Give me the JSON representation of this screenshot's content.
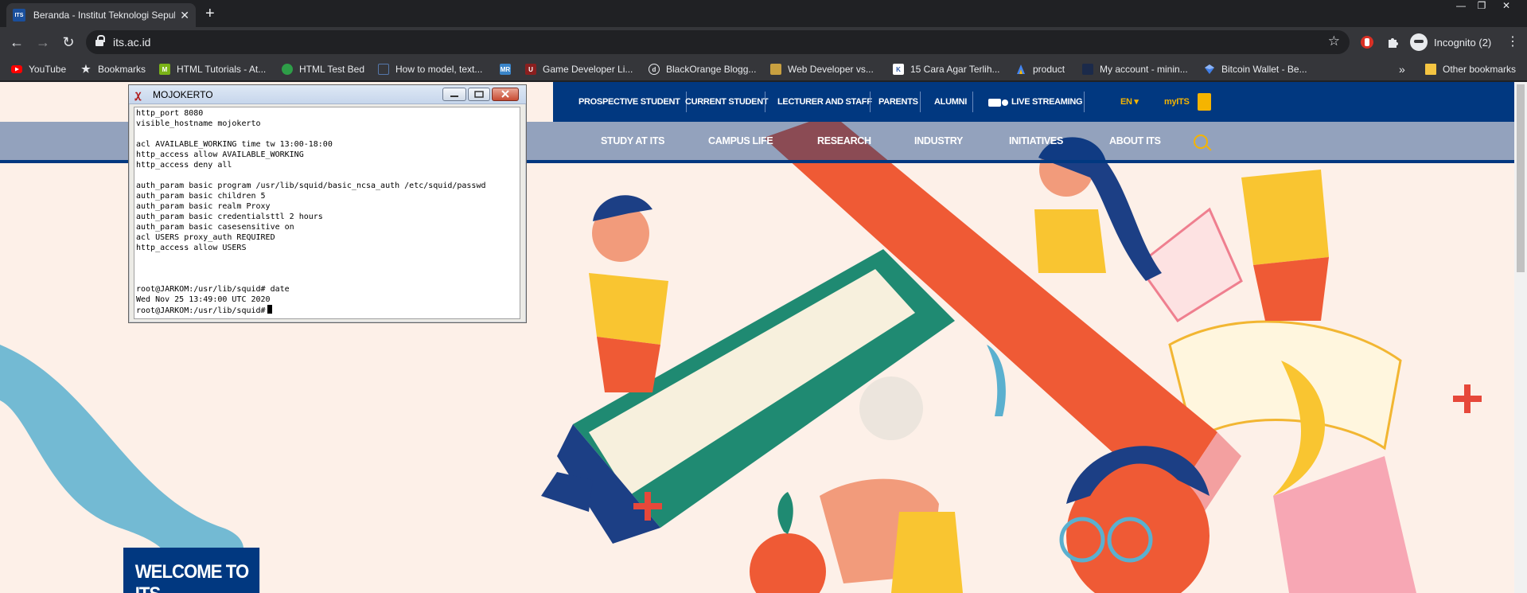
{
  "browser": {
    "tab": {
      "favicon_text": "ITS",
      "title": "Beranda - Institut Teknologi Sepuluh Nopember"
    },
    "newtab_symbol": "+",
    "close_symbol": "✕",
    "window_controls": [
      "—",
      "❐",
      "✕"
    ],
    "address": {
      "url": "its.ac.id"
    },
    "profile_label": "Incognito (2)",
    "bookmarks": [
      {
        "label": "YouTube",
        "icon": "youtube-icon",
        "color": "#ff0000"
      },
      {
        "label": "Bookmarks",
        "icon": "star-icon",
        "color": "#e8eaed"
      },
      {
        "label": "HTML Tutorials - At...",
        "icon": "html-tutorials-icon",
        "color": "#7ab317"
      },
      {
        "label": "HTML Test Bed",
        "icon": "test-bed-icon",
        "color": "#2e9e48"
      },
      {
        "label": "How to model, text...",
        "icon": "model-icon",
        "color": "#5577aa"
      },
      {
        "label": "",
        "icon": "mr-icon",
        "color": "#3a85c9"
      },
      {
        "label": "Game Developer Li...",
        "icon": "unreal-icon",
        "color": "#8a1f1f"
      },
      {
        "label": "BlackOrange Blogg...",
        "icon": "blogger-icon",
        "color": "#e8eaed"
      },
      {
        "label": "Web Developer vs...",
        "icon": "web-dev-icon",
        "color": "#c8a040"
      },
      {
        "label": "15 Cara Agar Terlih...",
        "icon": "cara-icon",
        "color": "#2f5aa8"
      },
      {
        "label": "product",
        "icon": "product-icon",
        "color": "#4285f4"
      },
      {
        "label": "My account - minin...",
        "icon": "account-icon",
        "color": "#1b2a4a"
      },
      {
        "label": "Bitcoin Wallet - Be...",
        "icon": "bitcoin-icon",
        "color": "#3f7ee8"
      }
    ],
    "bookmarks_overflow": "»",
    "other_bookmarks": "Other bookmarks"
  },
  "site": {
    "topbar": {
      "items": [
        "PROSPECTIVE STUDENT",
        "CURRENT STUDENT",
        "LECTURER AND STAFF",
        "PARENTS",
        "ALUMNI"
      ],
      "live": "LIVE STREAMING",
      "lang": "EN ▾",
      "myits": "myITS"
    },
    "mainnav": [
      "STUDY AT ITS",
      "CAMPUS LIFE",
      "RESEARCH",
      "INDUSTRY",
      "INITIATIVES",
      "ABOUT ITS"
    ],
    "welcome": "WELCOME TO ITS",
    "colors": {
      "navy": "#013880",
      "accent": "#f5b400",
      "hero_bg": "#fdf0e8"
    }
  },
  "terminal": {
    "title": "MOJOKERTO",
    "lines": [
      "http_port 8080",
      "visible_hostname mojokerto",
      "",
      "acl AVAILABLE_WORKING time tw 13:00-18:00",
      "http_access allow AVAILABLE_WORKING",
      "http_access deny all",
      "",
      "auth_param basic program /usr/lib/squid/basic_ncsa_auth /etc/squid/passwd",
      "auth_param basic children 5",
      "auth_param basic realm Proxy",
      "auth_param basic credentialsttl 2 hours",
      "auth_param basic casesensitive on",
      "acl USERS proxy_auth REQUIRED",
      "http_access allow USERS",
      "",
      "",
      "",
      "root@JARKOM:/usr/lib/squid# date",
      "Wed Nov 25 13:49:00 UTC 2020"
    ],
    "prompt": "root@JARKOM:/usr/lib/squid#"
  }
}
